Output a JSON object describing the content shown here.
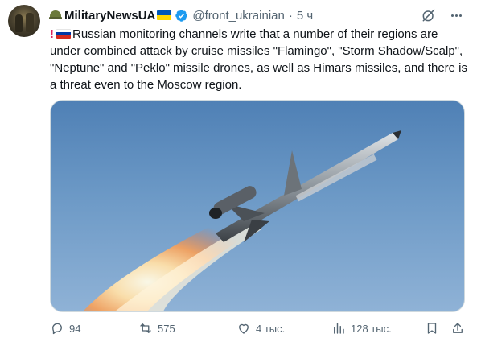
{
  "tweet": {
    "author": {
      "display_name": "MilitaryNewsUA",
      "handle": "@front_ukrainian",
      "separator": "·",
      "time": "5 ч",
      "verified": true
    },
    "text": "Russian monitoring channels write that a number of their regions are under combined attack by cruise missiles \"Flamingo\", \"Storm Shadow/Scalp\", \"Neptune\" and \"Peklo\" missile drones, as well as Himars missiles, and there is a threat even to the Moscow region.",
    "icons": {
      "prefix": [
        "exclamation-icon",
        "russia-flag-icon"
      ],
      "name_prefix": "helmet-icon",
      "name_suffix": "ukraine-flag-icon"
    },
    "actions": {
      "replies": "94",
      "reposts": "575",
      "likes": "4 тыс.",
      "views": "128 тыс."
    }
  },
  "colors": {
    "accent": "#1d9bf0",
    "secondary_text": "#536471",
    "flag_ua_blue": "#0057b7",
    "flag_ua_yellow": "#ffd700",
    "flag_ru_red": "#d52b1e",
    "flag_ru_blue": "#0039a6"
  }
}
